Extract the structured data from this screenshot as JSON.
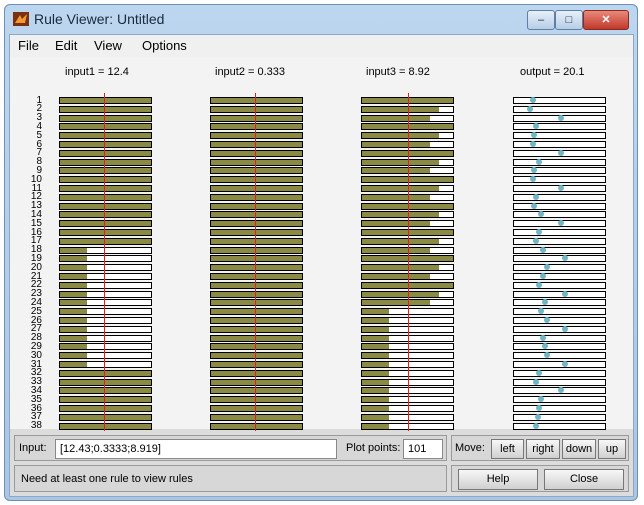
{
  "window": {
    "title": "Rule Viewer: Untitled",
    "min_glyph": "–",
    "max_glyph": "□",
    "close_glyph": "✕"
  },
  "menu": [
    "File",
    "Edit",
    "View",
    "Options"
  ],
  "variables": [
    {
      "label": "input1 = 12.4",
      "marker": 0.48
    },
    {
      "label": "input2 = 0.333",
      "marker": 0.48
    },
    {
      "label": "input3 = 8.92",
      "marker": 0.5
    },
    {
      "label": "output = 20.1"
    }
  ],
  "rules": {
    "count": 38,
    "input1": [
      1,
      1,
      1,
      1,
      1,
      1,
      1,
      1,
      1,
      1,
      1,
      1,
      1,
      1,
      1,
      1,
      1,
      0.3,
      0.3,
      0.3,
      0.3,
      0.3,
      0.3,
      0.3,
      0.3,
      0.3,
      0.3,
      0.3,
      0.3,
      0.3,
      0.3,
      1,
      1,
      1,
      1,
      1,
      1,
      1
    ],
    "input2": [
      1,
      1,
      1,
      1,
      1,
      1,
      1,
      1,
      1,
      1,
      1,
      1,
      1,
      1,
      1,
      1,
      1,
      1,
      1,
      1,
      1,
      1,
      1,
      1,
      1,
      1,
      1,
      1,
      1,
      1,
      1,
      1,
      1,
      1,
      1,
      1,
      1,
      1
    ],
    "input3": [
      1,
      0.85,
      0.75,
      1,
      0.85,
      0.75,
      1,
      0.85,
      0.75,
      1,
      0.85,
      0.75,
      1,
      0.85,
      0.75,
      1,
      0.85,
      0.75,
      1,
      0.85,
      0.75,
      1,
      0.85,
      0.75,
      0.3,
      0.3,
      0.3,
      0.3,
      0.3,
      0.3,
      0.3,
      0.3,
      0.3,
      0.3,
      0.3,
      0.3,
      0.3,
      0.3
    ],
    "output": [
      0.18,
      0.15,
      0.5,
      0.22,
      0.2,
      0.18,
      0.5,
      0.25,
      0.2,
      0.18,
      0.5,
      0.22,
      0.2,
      0.28,
      0.5,
      0.25,
      0.22,
      0.3,
      0.55,
      0.35,
      0.3,
      0.25,
      0.55,
      0.32,
      0.28,
      0.35,
      0.55,
      0.3,
      0.32,
      0.35,
      0.55,
      0.25,
      0.22,
      0.5,
      0.28,
      0.25,
      0.24,
      0.22
    ]
  },
  "controls": {
    "input_label": "Input:",
    "input_value": "[12.43;0.3333;8.919]",
    "plot_points_label": "Plot points:",
    "plot_points_value": "101",
    "move_label": "Move:",
    "move_left": "left",
    "move_right": "right",
    "move_down": "down",
    "move_up": "up",
    "status": "Need at least one rule to view rules",
    "help": "Help",
    "close": "Close"
  },
  "colors": {
    "fill": "#8a8a44",
    "marker": "#e21d1d",
    "dot": "#6fb7c7"
  }
}
